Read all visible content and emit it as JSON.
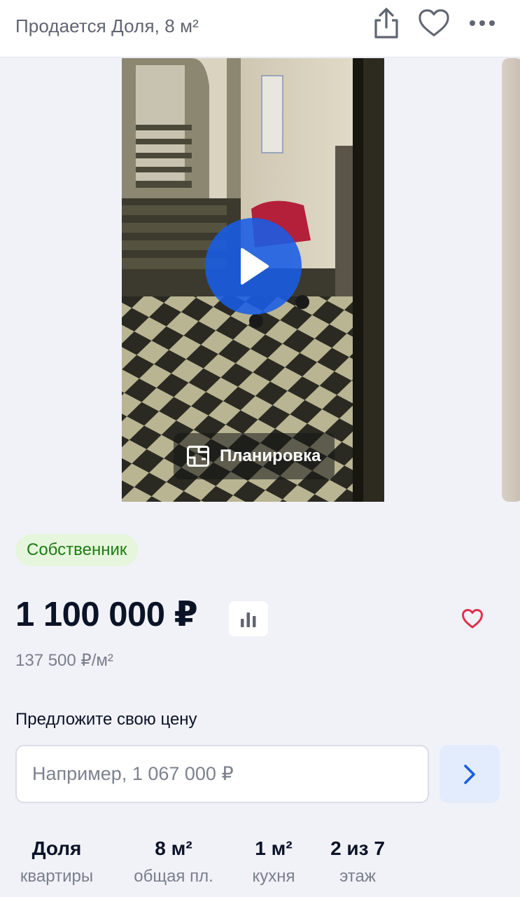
{
  "header": {
    "title": "Продается Доля, 8 м²",
    "icons": {
      "share": "share-icon",
      "favorite": "heart-outline-icon",
      "more": "more-horizontal-icon"
    }
  },
  "gallery": {
    "play_icon": "play-icon",
    "plan_label": "Планировка",
    "plan_icon": "floor-plan-icon"
  },
  "badge": {
    "label": "Собственник",
    "bg": "#e6f6dd",
    "color": "#1f7a12"
  },
  "price": {
    "value": "1 100 000 ₽",
    "per_meter": "137 500 ₽/м²",
    "chart_icon": "bar-chart-icon",
    "favorite_icon": "heart-outline-icon",
    "favorite_color": "#e0304e"
  },
  "offer": {
    "label": "Предложите свою цену",
    "placeholder": "Например, 1 067 000 ₽",
    "submit_icon": "chevron-right-icon",
    "accent": "#1560e0"
  },
  "facts": [
    {
      "value": "Доля",
      "label": "квартиры"
    },
    {
      "value": "8 м²",
      "label": "общая пл."
    },
    {
      "value": "1 м²",
      "label": "кухня"
    },
    {
      "value": "2 из 7",
      "label": "этаж"
    }
  ]
}
